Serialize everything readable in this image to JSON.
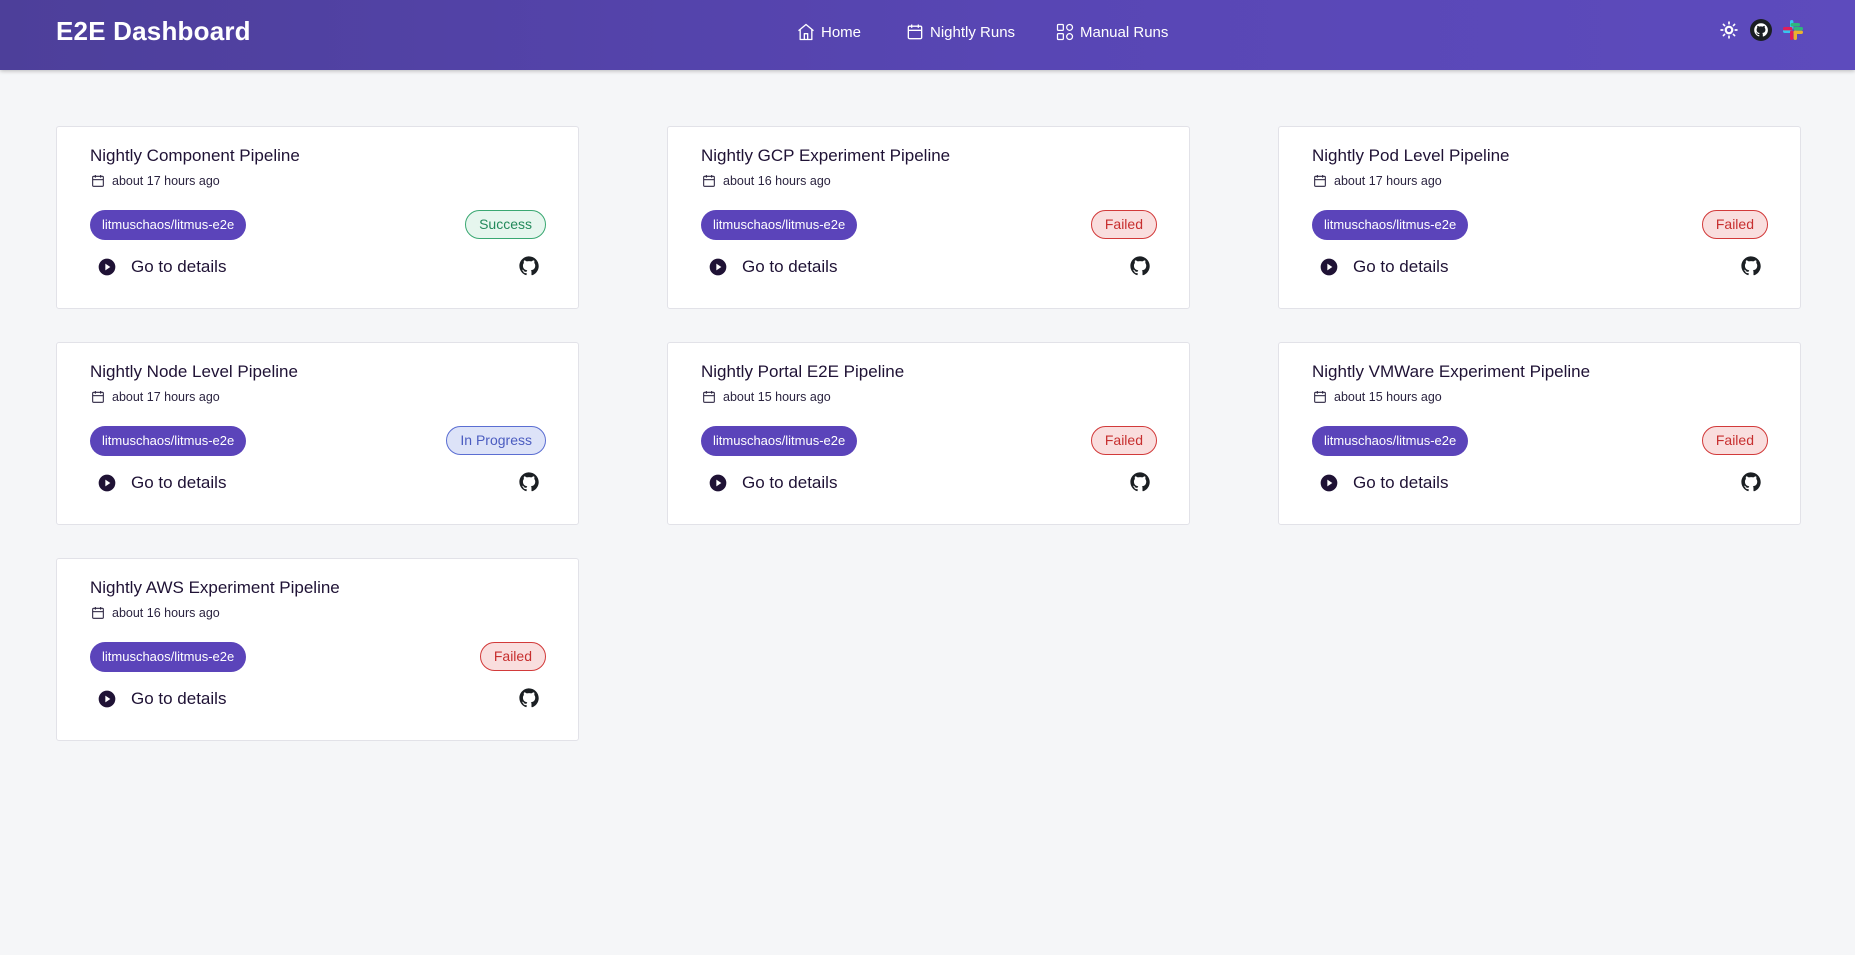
{
  "app": {
    "title": "E2E Dashboard"
  },
  "nav": [
    {
      "label": "Home",
      "icon": "home-icon"
    },
    {
      "label": "Nightly Runs",
      "icon": "calendar-icon"
    },
    {
      "label": "Manual Runs",
      "icon": "grid-icon"
    }
  ],
  "header_icons": [
    "theme-toggle-icon",
    "github-icon",
    "slack-icon"
  ],
  "colors": {
    "header": "#5846b4",
    "repo_badge": "#5b44ba",
    "success": "#238a5b",
    "failed": "#c72f2f",
    "in_progress": "#4b5cc0"
  },
  "pipelines": [
    {
      "title": "Nightly Component Pipeline",
      "time": "about 17 hours ago",
      "repo": "litmuschaos/litmus-e2e",
      "status": "Success",
      "details_label": "Go to details"
    },
    {
      "title": "Nightly GCP Experiment Pipeline",
      "time": "about 16 hours ago",
      "repo": "litmuschaos/litmus-e2e",
      "status": "Failed",
      "details_label": "Go to details"
    },
    {
      "title": "Nightly Pod Level Pipeline",
      "time": "about 17 hours ago",
      "repo": "litmuschaos/litmus-e2e",
      "status": "Failed",
      "details_label": "Go to details"
    },
    {
      "title": "Nightly Node Level Pipeline",
      "time": "about 17 hours ago",
      "repo": "litmuschaos/litmus-e2e",
      "status": "In Progress",
      "details_label": "Go to details"
    },
    {
      "title": "Nightly Portal E2E Pipeline",
      "time": "about 15 hours ago",
      "repo": "litmuschaos/litmus-e2e",
      "status": "Failed",
      "details_label": "Go to details"
    },
    {
      "title": "Nightly VMWare Experiment Pipeline",
      "time": "about 15 hours ago",
      "repo": "litmuschaos/litmus-e2e",
      "status": "Failed",
      "details_label": "Go to details"
    },
    {
      "title": "Nightly AWS Experiment Pipeline",
      "time": "about 16 hours ago",
      "repo": "litmuschaos/litmus-e2e",
      "status": "Failed",
      "details_label": "Go to details"
    }
  ]
}
